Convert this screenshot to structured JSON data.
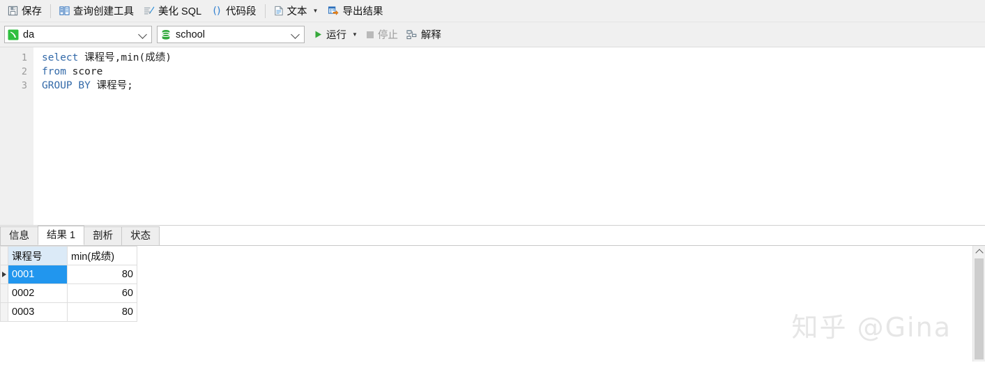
{
  "toolbar": {
    "items": [
      {
        "label": "保存",
        "icon": "save-icon"
      },
      {
        "label": "查询创建工具",
        "icon": "query-builder-icon"
      },
      {
        "label": "美化 SQL",
        "icon": "beautify-sql-icon"
      },
      {
        "label": "代码段",
        "icon": "code-snippet-icon"
      },
      {
        "label": "文本",
        "icon": "text-icon"
      },
      {
        "label": "导出结果",
        "icon": "export-result-icon"
      }
    ]
  },
  "connbar": {
    "connection": {
      "value": "da",
      "icon": "connection-icon"
    },
    "database": {
      "value": "school",
      "icon": "database-icon"
    },
    "run": {
      "label": "运行",
      "icon": "play-icon"
    },
    "stop": {
      "label": "停止",
      "icon": "stop-icon"
    },
    "explain": {
      "label": "解释",
      "icon": "explain-icon"
    }
  },
  "editor": {
    "lines": [
      {
        "num": "1",
        "keyword": "select",
        "rest": " 课程号,min(成绩)"
      },
      {
        "num": "2",
        "keyword": "from",
        "rest": " score"
      },
      {
        "num": "3",
        "keyword": "GROUP BY",
        "rest": " 课程号;"
      }
    ]
  },
  "result_tabs": [
    {
      "label": "信息",
      "active": false
    },
    {
      "label": "结果 1",
      "active": true
    },
    {
      "label": "剖析",
      "active": false
    },
    {
      "label": "状态",
      "active": false
    }
  ],
  "result_grid": {
    "columns": [
      "课程号",
      "min(成绩)"
    ],
    "rows": [
      {
        "课程号": "0001",
        "min(成绩)": "80",
        "selected": true
      },
      {
        "课程号": "0002",
        "min(成绩)": "60",
        "selected": false
      },
      {
        "课程号": "0003",
        "min(成绩)": "80",
        "selected": false
      }
    ]
  },
  "watermark": {
    "text": "知乎 @Gina"
  },
  "colors": {
    "toolbar_bg": "#f0f0f0",
    "accent_green": "#36a93b",
    "selection_blue": "#2196ee",
    "keyword_blue": "#3269a8",
    "selected_header": "#dbeaf7"
  }
}
